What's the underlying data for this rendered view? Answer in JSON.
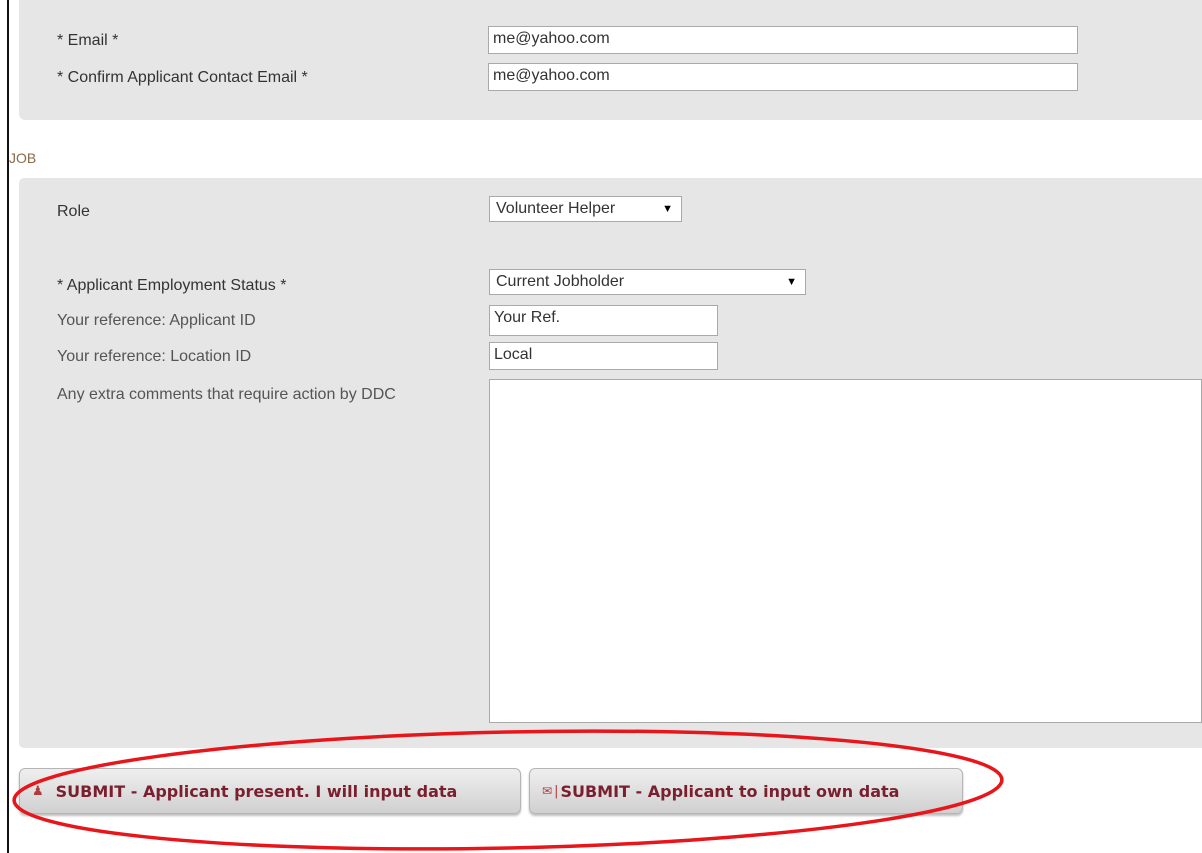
{
  "contact": {
    "email_label": "* Email *",
    "email_value": "me@yahoo.com",
    "confirm_label": "* Confirm Applicant Contact Email *",
    "confirm_value": "me@yahoo.com"
  },
  "job": {
    "section_title": "JOB",
    "role_label": "Role",
    "role_value": "Volunteer Helper",
    "status_label": "* Applicant Employment Status *",
    "status_value": "Current Jobholder",
    "applicant_id_label": "Your reference: Applicant ID",
    "applicant_id_value": "Your Ref.",
    "location_id_label": "Your reference: Location ID",
    "location_id_value": "Local",
    "comments_label": "Any extra comments that require action by DDC",
    "comments_value": ""
  },
  "actions": {
    "submit_present_label": "SUBMIT - Applicant present. I will input data",
    "submit_present_icon": "user-icon",
    "submit_own_label": "SUBMIT - Applicant to input own data",
    "submit_own_icon": "envelope-icon"
  },
  "annotation": {
    "highlight_color": "#e8151b"
  }
}
